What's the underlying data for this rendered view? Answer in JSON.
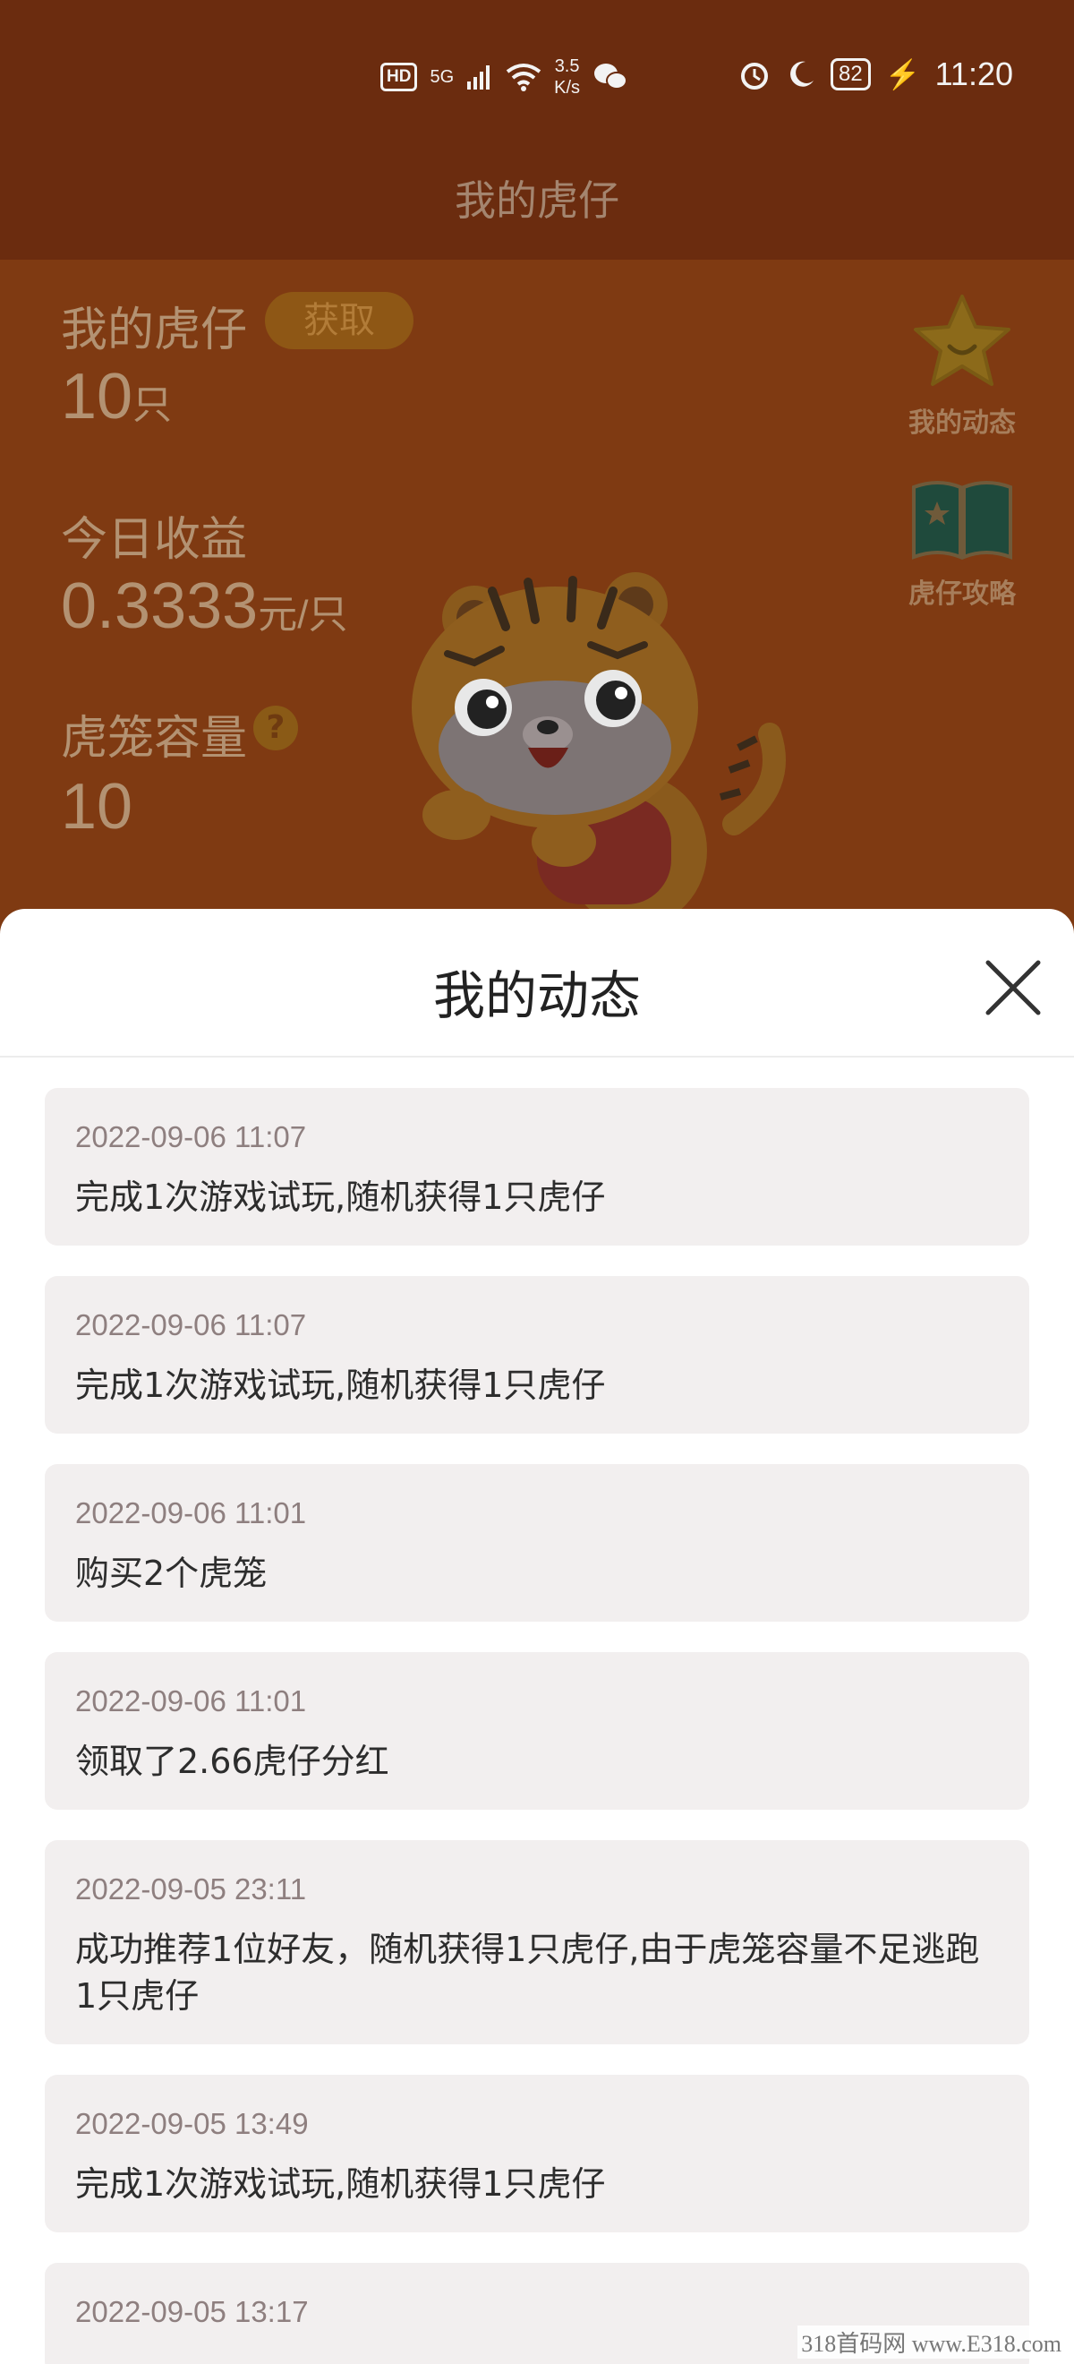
{
  "status_bar": {
    "hd": "HD",
    "net_5g": "5G",
    "speed_value": "3.5",
    "speed_unit": "K/s",
    "battery": "82",
    "time": "11:20"
  },
  "nav": {
    "title": "我的虎仔"
  },
  "stats": {
    "my_tigers_label": "我的虎仔",
    "get_button": "获取",
    "tiger_count": "10",
    "tiger_unit": "只",
    "today_income_label": "今日收益",
    "today_income_value": "0.3333",
    "today_income_unit": "元/只",
    "cage_capacity_label": "虎笼容量",
    "cage_capacity_help": "?",
    "cage_capacity_value": "10"
  },
  "side_buttons": {
    "my_activity": "我的动态",
    "tiger_guide": "虎仔攻略"
  },
  "sheet": {
    "title": "我的动态",
    "items": [
      {
        "time": "2022-09-06 11:07",
        "text": "完成1次游戏试玩,随机获得1只虎仔"
      },
      {
        "time": "2022-09-06 11:07",
        "text": "完成1次游戏试玩,随机获得1只虎仔"
      },
      {
        "time": "2022-09-06 11:01",
        "text": "购买2个虎笼"
      },
      {
        "time": "2022-09-06 11:01",
        "text": "领取了2.66虎仔分红"
      },
      {
        "time": "2022-09-05 23:11",
        "text": "成功推荐1位好友，随机获得1只虎仔,由于虎笼容量不足逃跑1只虎仔"
      },
      {
        "time": "2022-09-05 13:49",
        "text": "完成1次游戏试玩,随机获得1只虎仔"
      },
      {
        "time": "2022-09-05 13:17",
        "text": ""
      }
    ]
  },
  "watermark": "318首码网 www.E318.com",
  "colors": {
    "header_bg": "#6b2c0f",
    "hero_bg": "#7f3a12",
    "card_bg": "#f2efef",
    "sheet_bg": "#ffffff"
  }
}
